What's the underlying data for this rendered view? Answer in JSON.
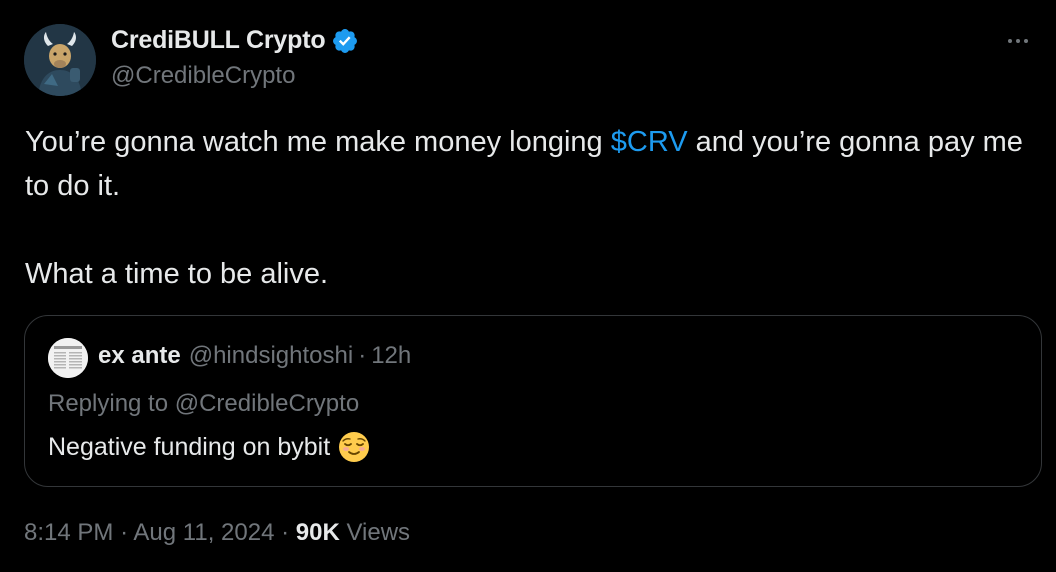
{
  "author": {
    "name": "CrediBULL Crypto",
    "handle": "@CredibleCrypto",
    "avatar_icon": "bull-avatar-icon",
    "verified_icon": "verified-badge-icon",
    "verified_color": "#1d9bf0"
  },
  "more_icon": "more-options-icon",
  "tweet": {
    "line1_before": "You’re gonna watch me make money longing ",
    "cashtag": "$CRV",
    "line1_after": " and you’re gonna pay me to do it.",
    "line2": "What a time to be alive."
  },
  "quote": {
    "name": "ex ante",
    "handle": "@hindsightoshi",
    "separator": "·",
    "time": "12h",
    "replying_to": "Replying to @CredibleCrypto",
    "text": "Negative funding on bybit",
    "emoji_icon": "relieved-face-emoji-icon"
  },
  "meta": {
    "time": "8:14 PM",
    "date": "Aug 11, 2024",
    "separator": "·",
    "views_count": "90K",
    "views_label": "Views"
  },
  "colors": {
    "background": "#000000",
    "text": "#e7e9ea",
    "muted": "#71767b",
    "link": "#1d9bf0",
    "border": "#333639"
  }
}
